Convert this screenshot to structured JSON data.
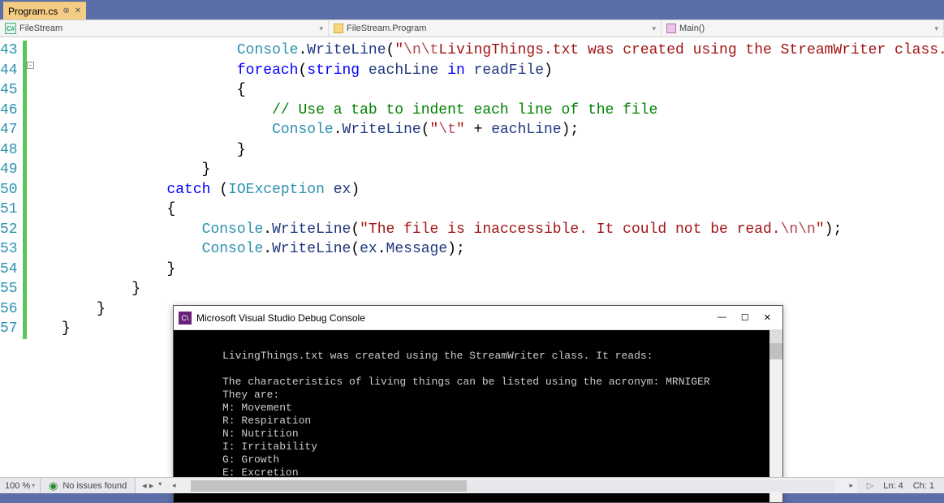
{
  "tab": {
    "label": "Program.cs"
  },
  "nav": {
    "left": "FileStream",
    "mid": "FileStream.Program",
    "right": "Main()"
  },
  "gutter_start": 43,
  "gutter_count": 15,
  "code_lines": [
    [
      [
        "type",
        "Console"
      ],
      [
        "plain",
        "."
      ],
      [
        "id",
        "WriteLine"
      ],
      [
        "plain",
        "("
      ],
      [
        "str",
        "\""
      ],
      [
        "esc",
        "\\n\\t"
      ],
      [
        "str",
        "LivingThings.txt was created using the StreamWriter class. It reads: "
      ],
      [
        "esc",
        "\\n"
      ],
      [
        "str",
        "\""
      ],
      [
        "plain",
        ");"
      ]
    ],
    [
      [
        "kw",
        "foreach"
      ],
      [
        "plain",
        "("
      ],
      [
        "kw",
        "string"
      ],
      [
        "plain",
        " "
      ],
      [
        "id",
        "eachLine"
      ],
      [
        "plain",
        " "
      ],
      [
        "kw",
        "in"
      ],
      [
        "plain",
        " "
      ],
      [
        "id",
        "readFile"
      ],
      [
        "plain",
        ")"
      ]
    ],
    [
      [
        "plain",
        "{"
      ]
    ],
    [
      [
        "plain",
        "    "
      ],
      [
        "cmt",
        "// Use a tab to indent each line of the file"
      ]
    ],
    [
      [
        "plain",
        "    "
      ],
      [
        "type",
        "Console"
      ],
      [
        "plain",
        "."
      ],
      [
        "id",
        "WriteLine"
      ],
      [
        "plain",
        "("
      ],
      [
        "str",
        "\""
      ],
      [
        "esc",
        "\\t"
      ],
      [
        "str",
        "\""
      ],
      [
        "plain",
        " + "
      ],
      [
        "id",
        "eachLine"
      ],
      [
        "plain",
        ");"
      ]
    ],
    [
      [
        "plain",
        "}"
      ]
    ],
    [
      [
        "plain",
        "}"
      ]
    ],
    [
      [
        "kw",
        "catch"
      ],
      [
        "plain",
        " ("
      ],
      [
        "type",
        "IOException"
      ],
      [
        "plain",
        " "
      ],
      [
        "id",
        "ex"
      ],
      [
        "plain",
        ")"
      ]
    ],
    [
      [
        "plain",
        "{"
      ]
    ],
    [
      [
        "type",
        "Console"
      ],
      [
        "plain",
        "."
      ],
      [
        "id",
        "WriteLine"
      ],
      [
        "plain",
        "("
      ],
      [
        "str",
        "\"The file is inaccessible. It could not be read."
      ],
      [
        "esc",
        "\\n\\n"
      ],
      [
        "str",
        "\""
      ],
      [
        "plain",
        ");"
      ]
    ],
    [
      [
        "type",
        "Console"
      ],
      [
        "plain",
        "."
      ],
      [
        "id",
        "WriteLine"
      ],
      [
        "plain",
        "("
      ],
      [
        "id",
        "ex"
      ],
      [
        "plain",
        "."
      ],
      [
        "id",
        "Message"
      ],
      [
        "plain",
        ");"
      ]
    ],
    [
      [
        "plain",
        "}"
      ]
    ],
    [
      [
        "plain",
        "}"
      ]
    ],
    [
      [
        "plain",
        "}"
      ]
    ],
    [
      [
        "plain",
        "}"
      ]
    ]
  ],
  "indents": [
    6,
    6,
    6,
    6,
    6,
    6,
    5,
    4,
    4,
    5,
    5,
    4,
    3,
    2,
    1
  ],
  "console": {
    "title": "Microsoft Visual Studio Debug Console",
    "output": "\nLivingThings.txt was created using the StreamWriter class. It reads:\n\nThe characteristics of living things can be listed using the acronym: MRNIGER\nThey are:\nM: Movement\nR: Respiration\nN: Nutrition\nI: Irritability\nG: Growth\nE: Excretion\nR: Reproduction. Most Important characteristic. Increase and multiply is a command."
  },
  "status": {
    "zoom": "100 %",
    "issues": "No issues found",
    "line": "Ln: 4",
    "col": "Ch: 1"
  }
}
